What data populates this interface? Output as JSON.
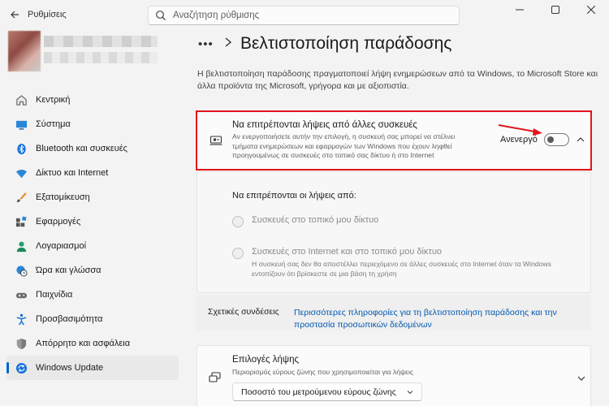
{
  "window": {
    "title": "Ρυθμίσεις",
    "search_placeholder": "Αναζήτηση ρύθμισης"
  },
  "sidebar": {
    "items": [
      {
        "label": "Κεντρική",
        "icon": "home-icon"
      },
      {
        "label": "Σύστημα",
        "icon": "monitor-icon"
      },
      {
        "label": "Bluetooth και συσκευές",
        "icon": "bluetooth-icon"
      },
      {
        "label": "Δίκτυο και Internet",
        "icon": "wifi-icon"
      },
      {
        "label": "Εξατομίκευση",
        "icon": "brush-icon"
      },
      {
        "label": "Εφαρμογές",
        "icon": "apps-icon"
      },
      {
        "label": "Λογαριασμοί",
        "icon": "person-icon"
      },
      {
        "label": "Ώρα και γλώσσα",
        "icon": "globe-clock-icon"
      },
      {
        "label": "Παιχνίδια",
        "icon": "gamepad-icon"
      },
      {
        "label": "Προσβασιμότητα",
        "icon": "accessibility-icon"
      },
      {
        "label": "Απόρρητο και ασφάλεια",
        "icon": "shield-icon"
      },
      {
        "label": "Windows Update",
        "icon": "update-icon",
        "active": true
      }
    ]
  },
  "header": {
    "breadcrumb_more": "•••",
    "title": "Βελτιστοποίηση παράδοσης",
    "description": "Η βελτιστοποίηση παράδοσης πραγματοποιεί λήψη ενημερώσεων από τα Windows, το Microsoft Store και άλλα προϊόντα της Microsoft, γρήγορα και με αξιοπιστία."
  },
  "allow_downloads": {
    "title": "Να επιτρέπονται λήψεις από άλλες συσκευές",
    "description": "Αν ενεργοποιήσετε αυτήν την επιλογή, η συσκευή σας μπορεί να στέλνει τμήματα ενημερώσεων και εφαρμογών των Windows που έχουν ληφθεί προηγουμένως σε συσκευές στο τοπικό σας δίκτυο ή στο Internet",
    "toggle_state_label": "Ανενεργό",
    "toggle_on": false
  },
  "allow_from": {
    "title": "Να επιτρέπονται οι λήψεις από:",
    "option1": "Συσκευές στο τοπικό μου δίκτυο",
    "option2": "Συσκευές στο Internet και στο τοπικό μου δίκτυο",
    "option2_desc": "Η συσκευή σας δεν θα αποστέλλει περιεχόμενο σε άλλες συσκευές στο Internet όταν τα Windows εντοπίζουν ότι βρίσκεστε σε μια βάση τη χρήση"
  },
  "related": {
    "label": "Σχετικές συνδέσεις",
    "link": "Περισσότερες πληροφορίες για τη βελτιστοποίηση παράδοσης και την προστασία προσωπικών δεδομένων"
  },
  "download_options": {
    "title": "Επιλογές λήψης",
    "description": "Περιορισμός εύρους ζώνης που χρησιμοποιείται για λήψεις",
    "select_value": "Ποσοστό του μετρούμενου εύρους ζώνης"
  },
  "colors": {
    "accent": "#0067c0",
    "highlight": "#e3141b",
    "link": "#0058b0"
  }
}
